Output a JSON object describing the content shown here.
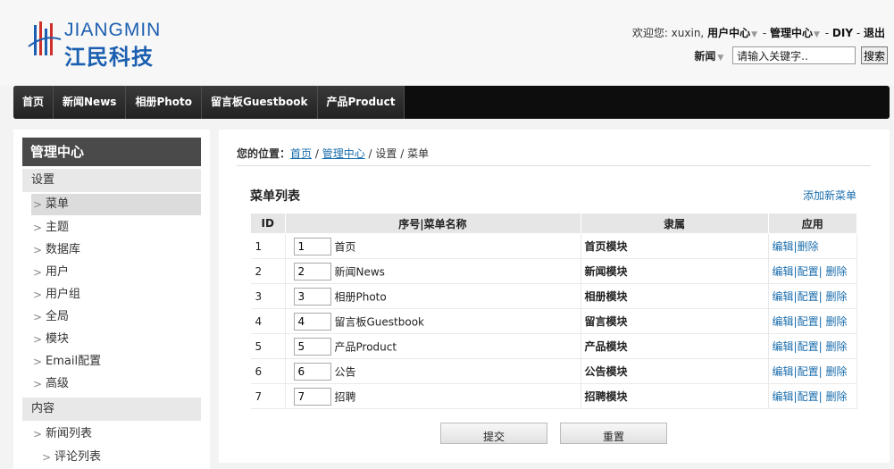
{
  "brand": {
    "name_en": "JIANGMIN",
    "name_cn": "江民科技"
  },
  "userbar": {
    "welcome": "欢迎您: xuxin,",
    "user_center": "用户中心",
    "manage_center": "管理中心",
    "diy": "DIY",
    "logout": "退出"
  },
  "search": {
    "category": "新闻",
    "placeholder": "请输入关键字..",
    "value": "请输入关键字..",
    "button": "搜索"
  },
  "nav": {
    "items": [
      "首页",
      "新闻News",
      "相册Photo",
      "留言板Guestbook",
      "产品Product"
    ]
  },
  "sidebar": {
    "title": "管理中心",
    "section_settings": "设置",
    "settings_items": [
      "菜单",
      "主题",
      "数据库",
      "用户",
      "用户组",
      "全局",
      "模块",
      "Email配置",
      "高级"
    ],
    "active_item": "菜单",
    "section_content": "内容",
    "content_items": [
      "新闻列表"
    ],
    "content_sub_items": [
      "评论列表"
    ]
  },
  "breadcrumb": {
    "label": "您的位置：",
    "home": "首页",
    "manage": "管理中心",
    "settings": "设置",
    "current": "菜单"
  },
  "panel": {
    "title": "菜单列表",
    "add_link": "添加新菜单"
  },
  "table": {
    "headers": {
      "id": "ID",
      "order_name": "序号|菜单名称",
      "belongs": "隶属",
      "apply": "应用"
    },
    "rows": [
      {
        "id": "1",
        "order": "1",
        "name": "首页",
        "module": "首页模块",
        "ops": [
          "编辑",
          "删除"
        ]
      },
      {
        "id": "2",
        "order": "2",
        "name": "新闻News",
        "module": "新闻模块",
        "ops": [
          "编辑",
          "配置",
          "删除"
        ]
      },
      {
        "id": "3",
        "order": "3",
        "name": "相册Photo",
        "module": "相册模块",
        "ops": [
          "编辑",
          "配置",
          "删除"
        ]
      },
      {
        "id": "4",
        "order": "4",
        "name": "留言板Guestbook",
        "module": "留言模块",
        "ops": [
          "编辑",
          "配置",
          "删除"
        ]
      },
      {
        "id": "5",
        "order": "5",
        "name": "产品Product",
        "module": "产品模块",
        "ops": [
          "编辑",
          "配置",
          "删除"
        ]
      },
      {
        "id": "6",
        "order": "6",
        "name": "公告",
        "module": "公告模块",
        "ops": [
          "编辑",
          "配置",
          "删除"
        ]
      },
      {
        "id": "7",
        "order": "7",
        "name": "招聘",
        "module": "招聘模块",
        "ops": [
          "编辑",
          "配置",
          "删除"
        ]
      }
    ]
  },
  "buttons": {
    "submit": "提交",
    "reset": "重置"
  },
  "colors": {
    "link": "#1a6dad",
    "brand": "#1b5fb0",
    "logo_red": "#d0302a",
    "nav_bg": "#0d0d0d"
  }
}
